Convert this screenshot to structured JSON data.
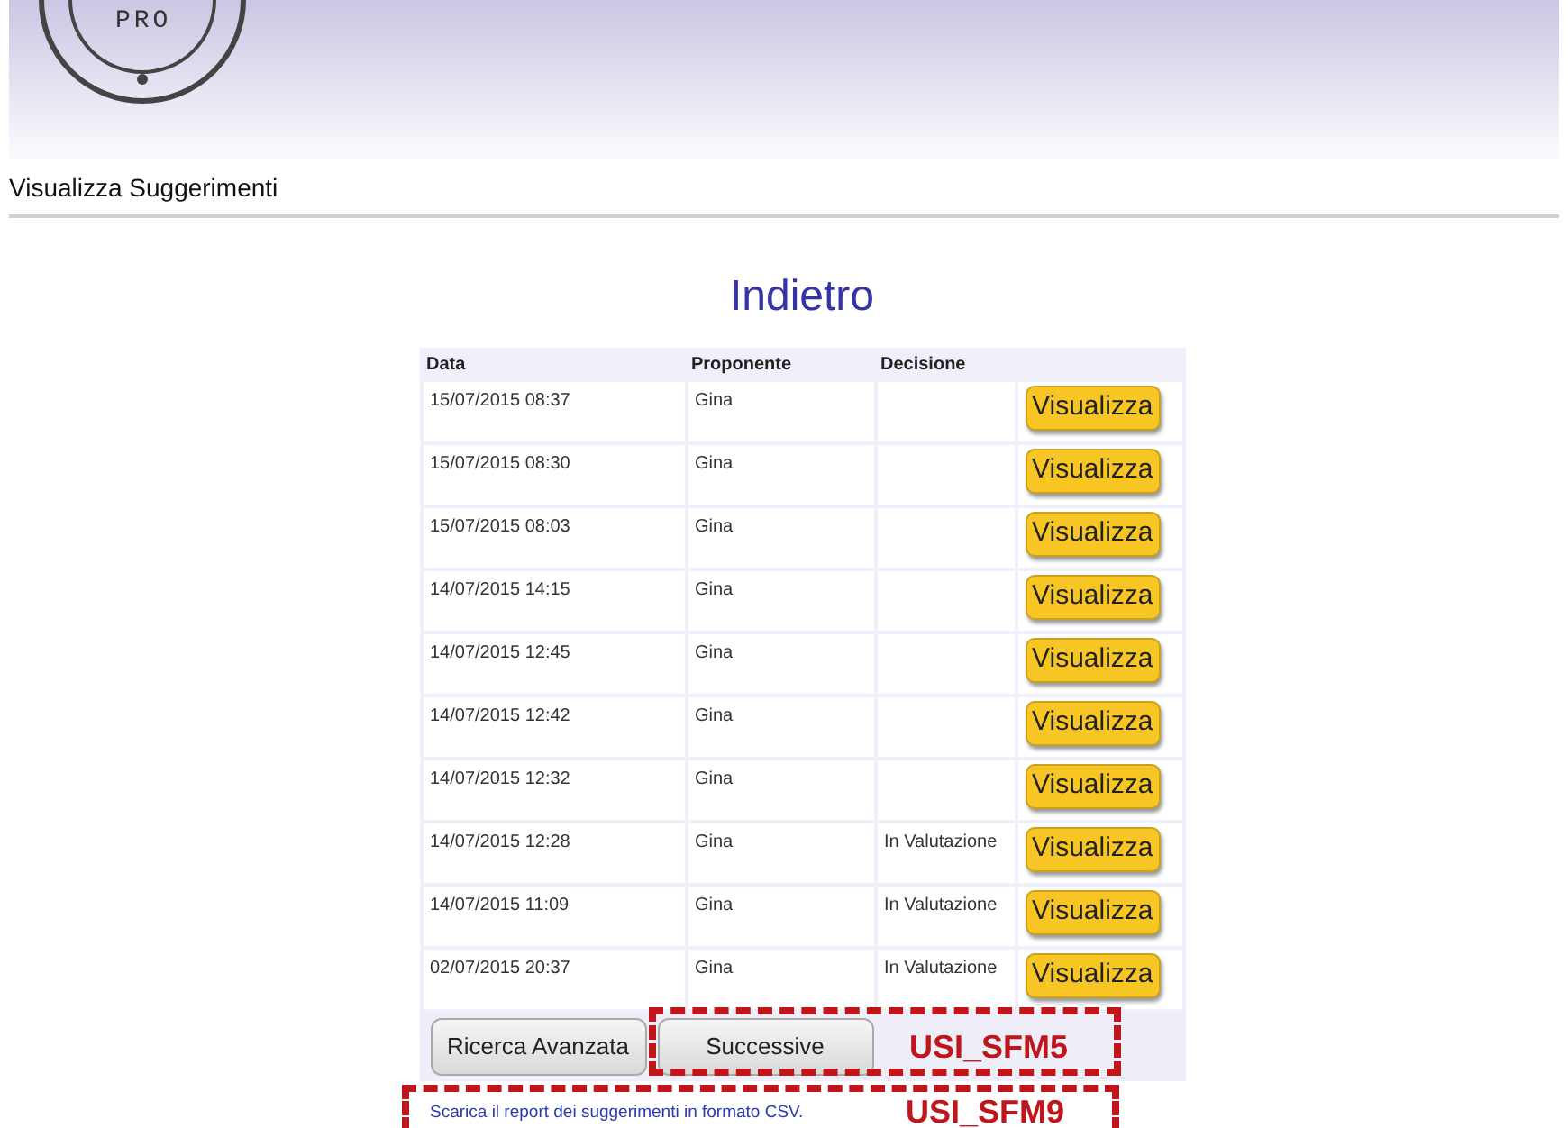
{
  "logo": {
    "text": "PRO"
  },
  "page_title": "Visualizza Suggerimenti",
  "back_link": "Indietro",
  "table": {
    "columns": [
      "Data",
      "Proponente",
      "Decisione"
    ],
    "rows": [
      {
        "data": "15/07/2015 08:37",
        "proponente": "Gina",
        "action": "Visualizza"
      },
      {
        "data": "15/07/2015 08:30",
        "proponente": "Gina",
        "action": "Visualizza"
      },
      {
        "data": "15/07/2015 08:03",
        "proponente": "Gina",
        "action": "Visualizza"
      },
      {
        "data": "14/07/2015 14:15",
        "proponente": "Gina",
        "action": "Visualizza"
      },
      {
        "data": "14/07/2015 12:45",
        "proponente": "Gina",
        "action": "Visualizza"
      },
      {
        "data": "14/07/2015 12:42",
        "proponente": "Gina",
        "action": "Visualizza"
      },
      {
        "data": "14/07/2015 12:32",
        "proponente": "Gina",
        "action": "Visualizza"
      },
      {
        "data": "14/07/2015 12:28",
        "proponente": "Gina",
        "decisione": "In Valutazione",
        "action": "Visualizza"
      },
      {
        "data": "14/07/2015 11:09",
        "proponente": "Gina",
        "decisione": "In Valutazione",
        "action": "Visualizza"
      },
      {
        "data": "02/07/2015 20:37",
        "proponente": "Gina",
        "decisione": "In Valutazione",
        "action": "Visualizza"
      }
    ]
  },
  "footer_buttons": [
    "Ricerca Avanzata",
    "Successive"
  ],
  "csv_link": "Scarica il report dei suggerimenti in formato CSV.",
  "annotations": [
    {
      "label": "USI_SFM5",
      "kind": "closed"
    },
    {
      "label": "USI_SFM9",
      "kind": "open"
    }
  ]
}
